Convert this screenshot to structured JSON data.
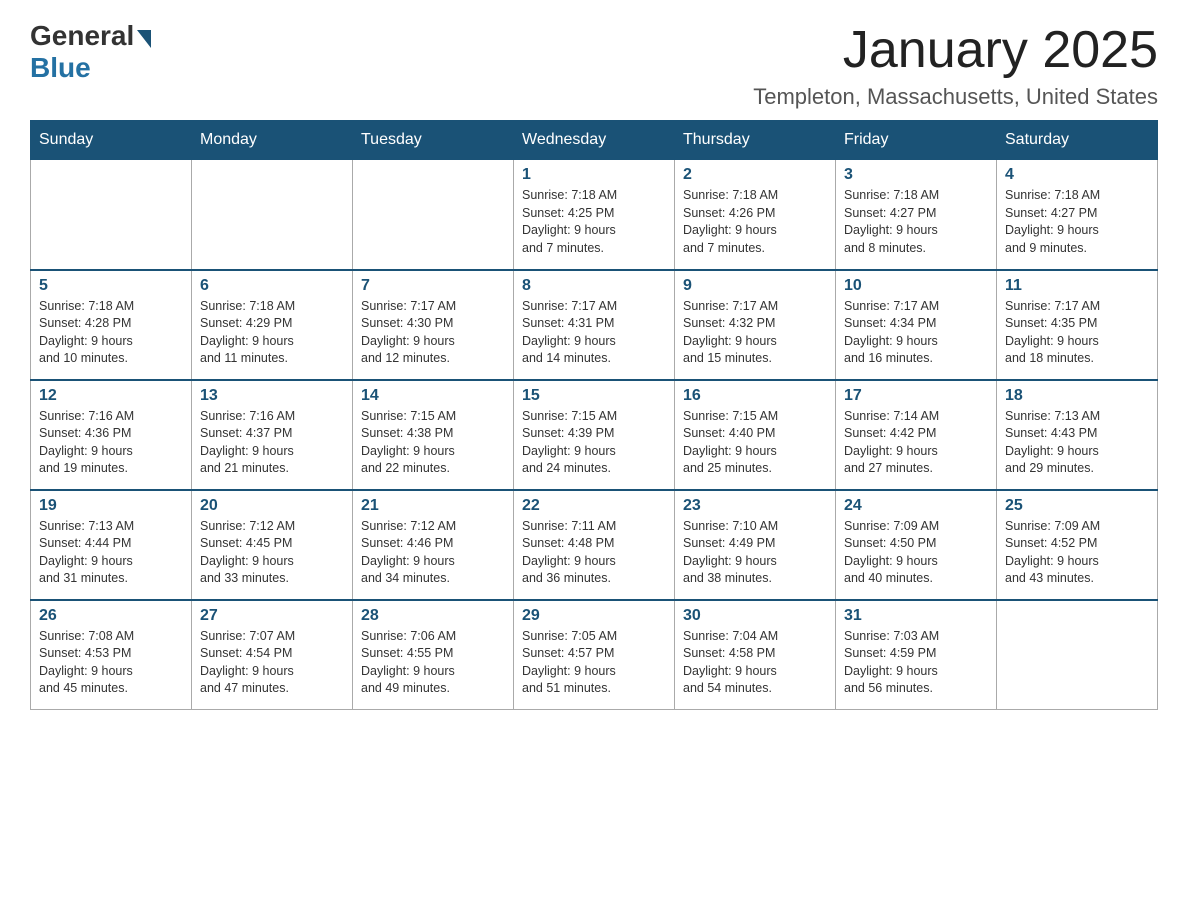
{
  "header": {
    "logo_general": "General",
    "logo_blue": "Blue",
    "month_title": "January 2025",
    "location": "Templeton, Massachusetts, United States"
  },
  "weekdays": [
    "Sunday",
    "Monday",
    "Tuesday",
    "Wednesday",
    "Thursday",
    "Friday",
    "Saturday"
  ],
  "weeks": [
    [
      {
        "day": "",
        "info": ""
      },
      {
        "day": "",
        "info": ""
      },
      {
        "day": "",
        "info": ""
      },
      {
        "day": "1",
        "info": "Sunrise: 7:18 AM\nSunset: 4:25 PM\nDaylight: 9 hours\nand 7 minutes."
      },
      {
        "day": "2",
        "info": "Sunrise: 7:18 AM\nSunset: 4:26 PM\nDaylight: 9 hours\nand 7 minutes."
      },
      {
        "day": "3",
        "info": "Sunrise: 7:18 AM\nSunset: 4:27 PM\nDaylight: 9 hours\nand 8 minutes."
      },
      {
        "day": "4",
        "info": "Sunrise: 7:18 AM\nSunset: 4:27 PM\nDaylight: 9 hours\nand 9 minutes."
      }
    ],
    [
      {
        "day": "5",
        "info": "Sunrise: 7:18 AM\nSunset: 4:28 PM\nDaylight: 9 hours\nand 10 minutes."
      },
      {
        "day": "6",
        "info": "Sunrise: 7:18 AM\nSunset: 4:29 PM\nDaylight: 9 hours\nand 11 minutes."
      },
      {
        "day": "7",
        "info": "Sunrise: 7:17 AM\nSunset: 4:30 PM\nDaylight: 9 hours\nand 12 minutes."
      },
      {
        "day": "8",
        "info": "Sunrise: 7:17 AM\nSunset: 4:31 PM\nDaylight: 9 hours\nand 14 minutes."
      },
      {
        "day": "9",
        "info": "Sunrise: 7:17 AM\nSunset: 4:32 PM\nDaylight: 9 hours\nand 15 minutes."
      },
      {
        "day": "10",
        "info": "Sunrise: 7:17 AM\nSunset: 4:34 PM\nDaylight: 9 hours\nand 16 minutes."
      },
      {
        "day": "11",
        "info": "Sunrise: 7:17 AM\nSunset: 4:35 PM\nDaylight: 9 hours\nand 18 minutes."
      }
    ],
    [
      {
        "day": "12",
        "info": "Sunrise: 7:16 AM\nSunset: 4:36 PM\nDaylight: 9 hours\nand 19 minutes."
      },
      {
        "day": "13",
        "info": "Sunrise: 7:16 AM\nSunset: 4:37 PM\nDaylight: 9 hours\nand 21 minutes."
      },
      {
        "day": "14",
        "info": "Sunrise: 7:15 AM\nSunset: 4:38 PM\nDaylight: 9 hours\nand 22 minutes."
      },
      {
        "day": "15",
        "info": "Sunrise: 7:15 AM\nSunset: 4:39 PM\nDaylight: 9 hours\nand 24 minutes."
      },
      {
        "day": "16",
        "info": "Sunrise: 7:15 AM\nSunset: 4:40 PM\nDaylight: 9 hours\nand 25 minutes."
      },
      {
        "day": "17",
        "info": "Sunrise: 7:14 AM\nSunset: 4:42 PM\nDaylight: 9 hours\nand 27 minutes."
      },
      {
        "day": "18",
        "info": "Sunrise: 7:13 AM\nSunset: 4:43 PM\nDaylight: 9 hours\nand 29 minutes."
      }
    ],
    [
      {
        "day": "19",
        "info": "Sunrise: 7:13 AM\nSunset: 4:44 PM\nDaylight: 9 hours\nand 31 minutes."
      },
      {
        "day": "20",
        "info": "Sunrise: 7:12 AM\nSunset: 4:45 PM\nDaylight: 9 hours\nand 33 minutes."
      },
      {
        "day": "21",
        "info": "Sunrise: 7:12 AM\nSunset: 4:46 PM\nDaylight: 9 hours\nand 34 minutes."
      },
      {
        "day": "22",
        "info": "Sunrise: 7:11 AM\nSunset: 4:48 PM\nDaylight: 9 hours\nand 36 minutes."
      },
      {
        "day": "23",
        "info": "Sunrise: 7:10 AM\nSunset: 4:49 PM\nDaylight: 9 hours\nand 38 minutes."
      },
      {
        "day": "24",
        "info": "Sunrise: 7:09 AM\nSunset: 4:50 PM\nDaylight: 9 hours\nand 40 minutes."
      },
      {
        "day": "25",
        "info": "Sunrise: 7:09 AM\nSunset: 4:52 PM\nDaylight: 9 hours\nand 43 minutes."
      }
    ],
    [
      {
        "day": "26",
        "info": "Sunrise: 7:08 AM\nSunset: 4:53 PM\nDaylight: 9 hours\nand 45 minutes."
      },
      {
        "day": "27",
        "info": "Sunrise: 7:07 AM\nSunset: 4:54 PM\nDaylight: 9 hours\nand 47 minutes."
      },
      {
        "day": "28",
        "info": "Sunrise: 7:06 AM\nSunset: 4:55 PM\nDaylight: 9 hours\nand 49 minutes."
      },
      {
        "day": "29",
        "info": "Sunrise: 7:05 AM\nSunset: 4:57 PM\nDaylight: 9 hours\nand 51 minutes."
      },
      {
        "day": "30",
        "info": "Sunrise: 7:04 AM\nSunset: 4:58 PM\nDaylight: 9 hours\nand 54 minutes."
      },
      {
        "day": "31",
        "info": "Sunrise: 7:03 AM\nSunset: 4:59 PM\nDaylight: 9 hours\nand 56 minutes."
      },
      {
        "day": "",
        "info": ""
      }
    ]
  ]
}
